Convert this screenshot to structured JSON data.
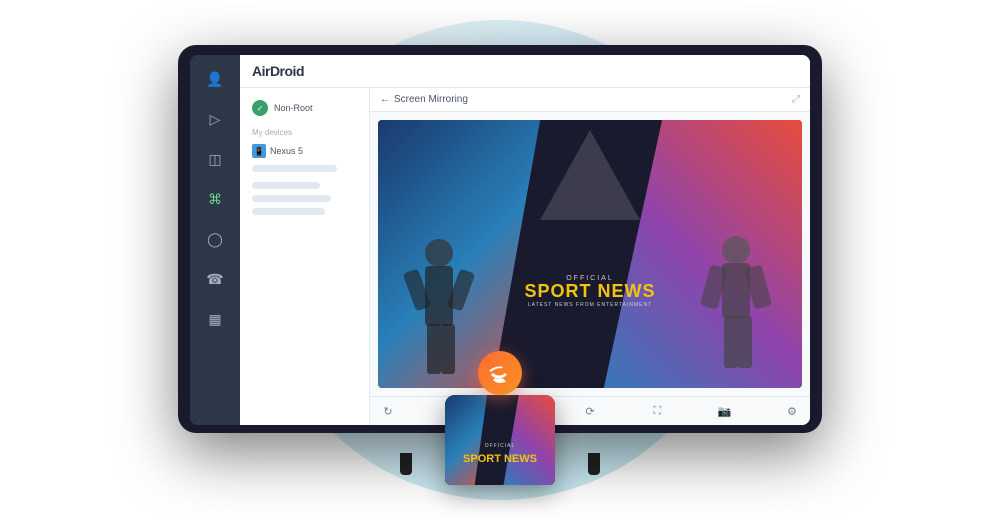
{
  "app": {
    "name": "AirDroid",
    "tagline": "Screen Mirroring"
  },
  "sidebar": {
    "icons": [
      {
        "name": "user-icon",
        "symbol": "👤",
        "active": false
      },
      {
        "name": "play-icon",
        "symbol": "▷",
        "active": false
      },
      {
        "name": "file-icon",
        "symbol": "📁",
        "active": false
      },
      {
        "name": "binoculars-icon",
        "symbol": "🔭",
        "active": true
      },
      {
        "name": "bell-icon",
        "symbol": "🔔",
        "active": false
      },
      {
        "name": "phone-icon",
        "symbol": "📞",
        "active": false
      },
      {
        "name": "image-icon",
        "symbol": "🖼",
        "active": false
      }
    ]
  },
  "user": {
    "name": "Non-Root",
    "status": "online"
  },
  "devices": {
    "section_label": "My devices",
    "list": [
      {
        "name": "Nexus 5"
      }
    ]
  },
  "screen_mirror": {
    "title": "Screen Mirroring"
  },
  "sport_news": {
    "official_label": "OFFICIAL",
    "title": "SPORT NEWS",
    "sub_label": "LATEST NEWS FROM ENTERTAINMENT"
  },
  "controls": {
    "icons": [
      "rotate-icon",
      "mirror-icon",
      "pause-icon",
      "refresh-icon",
      "expand-icon",
      "camera-icon",
      "settings-icon"
    ]
  },
  "wifi_button": {
    "label": "wifi"
  },
  "phone": {
    "sport_official": "OFFICIAL",
    "sport_title": "SPORT NEWS"
  }
}
